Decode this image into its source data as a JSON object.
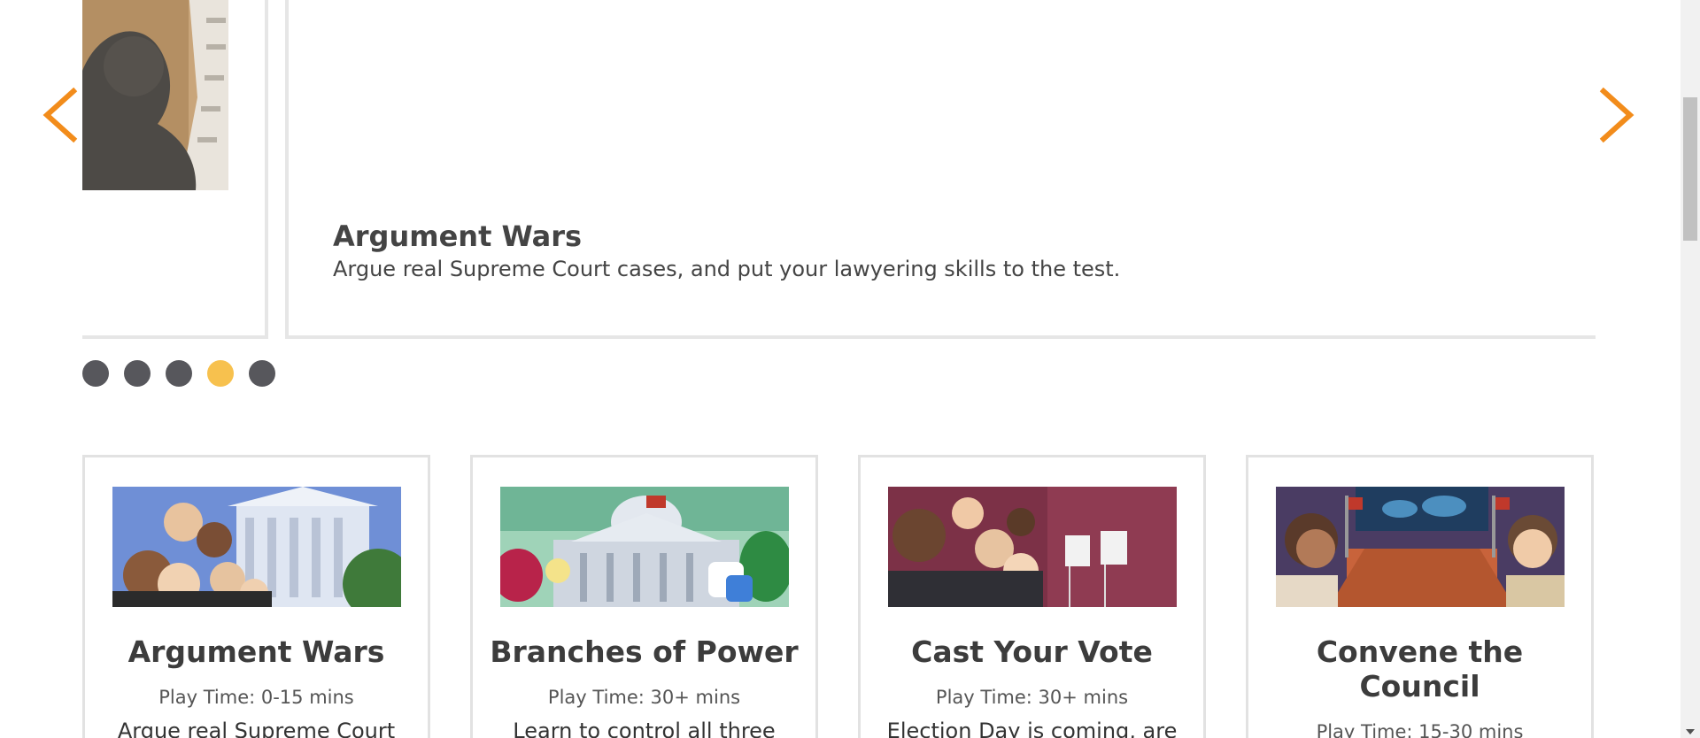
{
  "carousel": {
    "prev_icon": "chevron-left-icon",
    "next_icon": "chevron-right-icon",
    "arrow_color": "#f28c1b",
    "current_slide": {
      "title": "Argument Wars",
      "description": "Argue real Supreme Court cases, and put your lawyering skills to the test."
    },
    "dots": [
      {
        "active": false
      },
      {
        "active": false
      },
      {
        "active": false
      },
      {
        "active": true
      },
      {
        "active": false
      }
    ],
    "dot_color": "#57575c",
    "active_dot_color": "#f7c14e"
  },
  "games": [
    {
      "title": "Argument Wars",
      "play_time": "Play Time: 0-15 mins",
      "description": "Argue real Supreme Court"
    },
    {
      "title": "Branches of Power",
      "play_time": "Play Time: 30+ mins",
      "description": "Learn to control all three"
    },
    {
      "title": "Cast Your Vote",
      "play_time": "Play Time: 30+ mins",
      "description": "Election Day is coming, are"
    },
    {
      "title": "Convene the Council",
      "play_time": "Play Time: 15-30 mins",
      "description": ""
    }
  ]
}
